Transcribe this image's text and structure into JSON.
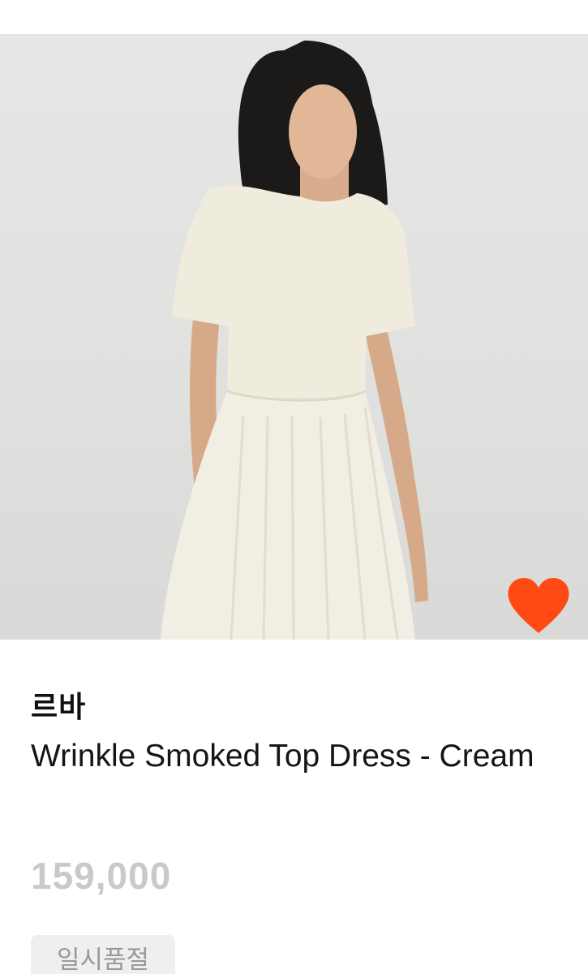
{
  "product": {
    "brand": "르바",
    "name": "Wrinkle Smoked Top Dress - Cream",
    "price": "159,000",
    "status": "일시품절",
    "liked": true
  },
  "colors": {
    "like_heart": "#ff4a14",
    "price": "#c9c9c9",
    "status_bg": "#efefef",
    "status_text": "#9a9a9a"
  },
  "icons": {
    "like": "heart-icon"
  }
}
